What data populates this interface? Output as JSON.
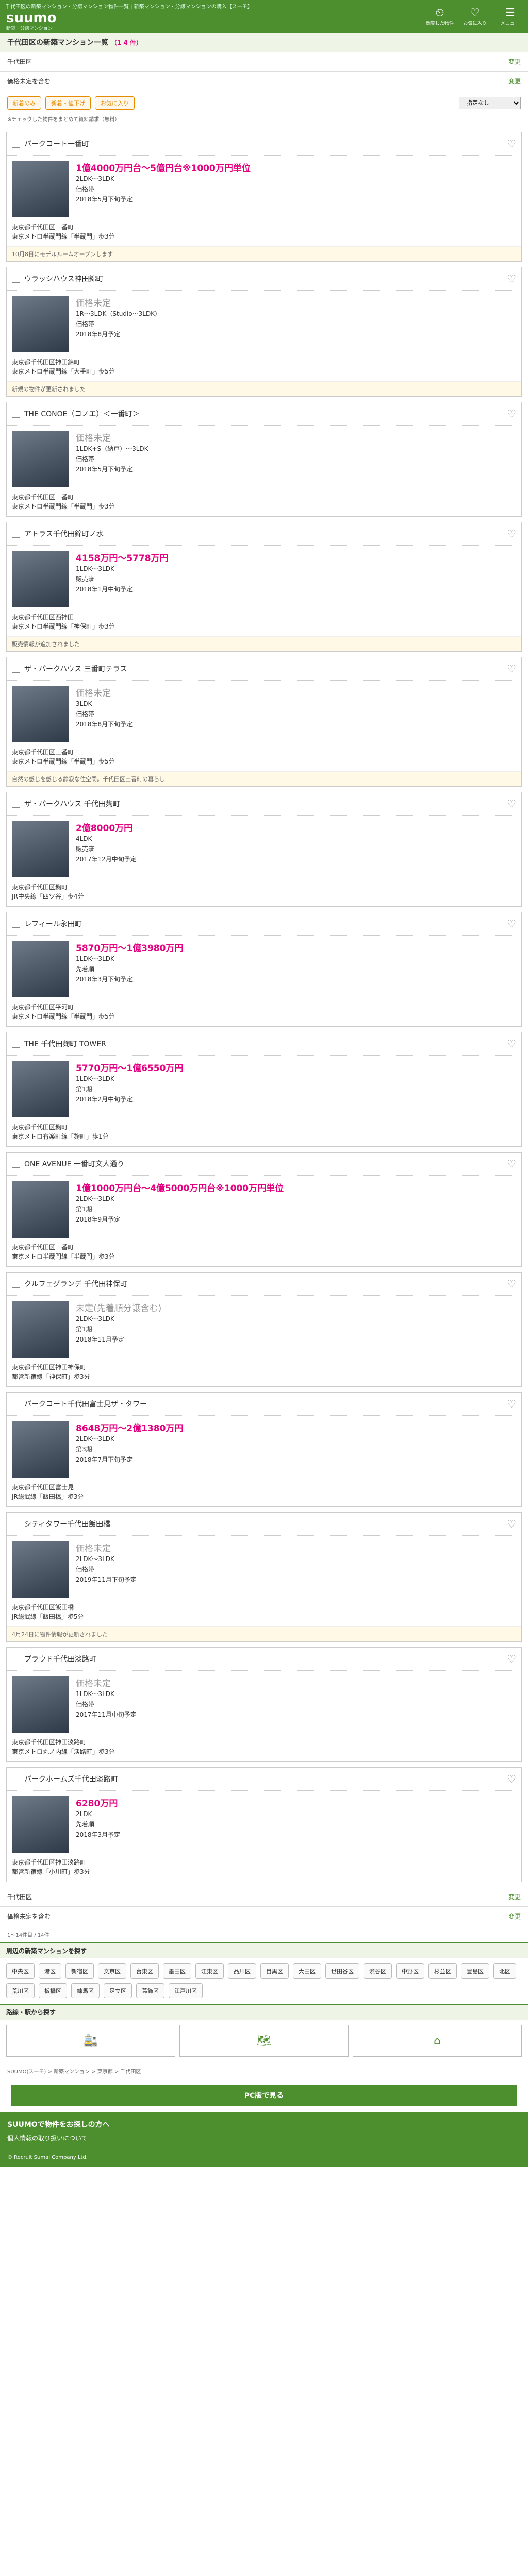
{
  "header": {
    "breadcrumb": "千代田区の新築マンション・分譲マンション物件一覧 | 新築マンション・分譲マンションの購入【スーモ】",
    "logo": "suumo",
    "subtitle": "新築・分譲マンション",
    "icons": [
      {
        "label": "閲覧した物件"
      },
      {
        "label": "お気に入り"
      },
      {
        "label": "メニュー"
      }
    ]
  },
  "title": {
    "text": "千代田区の新築マンション一覧",
    "count": "（1 4 件）"
  },
  "filters": {
    "row1_label": "千代田区",
    "row1_action": "変更",
    "row2_label": "価格未定を含む",
    "row2_action": "変更"
  },
  "buttons": {
    "b1": "新着のみ",
    "b2": "新着・値下げ",
    "b3": "お気に入り",
    "sort": "指定なし"
  },
  "note": "※チェックした物件をまとめて資料請求（無料）",
  "cards": [
    {
      "name": "パークコート一番町",
      "price": "1億4000万円台～5億円台※1000万円単位",
      "plan": "2LDK～3LDK",
      "sub": "価格帯",
      "date": "2018年5月下旬予定",
      "addr1": "東京都千代田区一番町",
      "addr2": "東京メトロ半蔵門線「半蔵門」歩3分",
      "info": "10月8日にモデルルームオープンします"
    },
    {
      "name": "ウラッシハウス神田錦町",
      "price": "価格未定",
      "plan": "1R～3LDK（Studio～3LDK）",
      "sub": "価格帯",
      "date": "2018年8月予定",
      "addr1": "東京都千代田区神田錦町",
      "addr2": "東京メトロ半蔵門線「大手町」歩5分",
      "info": "新規の物件が更新されました"
    },
    {
      "name": "THE CONOE（コノエ）＜一番町＞",
      "price": "価格未定",
      "plan": "1LDK+S（納戸）～3LDK",
      "sub": "価格帯",
      "date": "2018年5月下旬予定",
      "addr1": "東京都千代田区一番町",
      "addr2": "東京メトロ半蔵門線「半蔵門」歩3分",
      "info": ""
    },
    {
      "name": "アトラス千代田錦町ノ水",
      "price": "4158万円～5778万円",
      "plan": "1LDK～3LDK",
      "sub": "販売済",
      "date": "2018年1月中旬予定",
      "addr1": "東京都千代田区西神田",
      "addr2": "東京メトロ半蔵門線「神保町」歩3分",
      "info": "販売情報が追加されました"
    },
    {
      "name": "ザ・パークハウス 三番町テラス",
      "price": "価格未定",
      "plan": "3LDK",
      "sub": "価格帯",
      "date": "2018年8月下旬予定",
      "addr1": "東京都千代田区三番町",
      "addr2": "東京メトロ半蔵門線「半蔵門」歩5分",
      "info": "自然の感じを感じる静寂な住空間。千代田区三番町の暮らし"
    },
    {
      "name": "ザ・パークハウス 千代田麹町",
      "price": "2億8000万円",
      "plan": "4LDK",
      "sub": "販売済",
      "date": "2017年12月中旬予定",
      "addr1": "東京都千代田区麹町",
      "addr2": "JR中央線「四ツ谷」歩4分",
      "info": ""
    },
    {
      "name": "レフィール永田町",
      "price": "5870万円～1億3980万円",
      "plan": "1LDK～3LDK",
      "sub": "先着順",
      "date": "2018年3月下旬予定",
      "addr1": "東京都千代田区平河町",
      "addr2": "東京メトロ半蔵門線「半蔵門」歩5分",
      "info": ""
    },
    {
      "name": "THE 千代田麹町 TOWER",
      "price": "5770万円～1億6550万円",
      "plan": "1LDK～3LDK",
      "sub": "第1期",
      "date": "2018年2月中旬予定",
      "addr1": "東京都千代田区麹町",
      "addr2": "東京メトロ有楽町線「麹町」歩1分",
      "info": ""
    },
    {
      "name": "ONE AVENUE 一番町文人通り",
      "price": "1億1000万円台～4億5000万円台※1000万円単位",
      "plan": "2LDK～3LDK",
      "sub": "第1期",
      "date": "2018年9月予定",
      "addr1": "東京都千代田区一番町",
      "addr2": "東京メトロ半蔵門線「半蔵門」歩3分",
      "info": ""
    },
    {
      "name": "クルフェグランデ 千代田神保町",
      "price": "未定(先着順分譲含む)",
      "plan": "2LDK～3LDK",
      "sub": "第1期",
      "date": "2018年11月予定",
      "addr1": "東京都千代田区神田神保町",
      "addr2": "都営新宿線「神保町」歩3分",
      "info": ""
    },
    {
      "name": "パークコート千代田富士見ザ・タワー",
      "price": "8648万円～2億1380万円",
      "plan": "2LDK～3LDK",
      "sub": "第3期",
      "date": "2018年7月下旬予定",
      "addr1": "東京都千代田区富士見",
      "addr2": "JR総武線「飯田橋」歩3分",
      "info": ""
    },
    {
      "name": "シティタワー千代田飯田橋",
      "price": "価格未定",
      "plan": "2LDK～3LDK",
      "sub": "価格帯",
      "date": "2019年11月下旬予定",
      "addr1": "東京都千代田区飯田橋",
      "addr2": "JR総武線「飯田橋」歩5分",
      "info": "4月24日に物件情報が更新されました"
    },
    {
      "name": "プラウド千代田淡路町",
      "price": "価格未定",
      "plan": "1LDK～3LDK",
      "sub": "価格帯",
      "date": "2017年11月中旬予定",
      "addr1": "東京都千代田区神田淡路町",
      "addr2": "東京メトロ丸ノ内線「淡路町」歩3分",
      "info": ""
    },
    {
      "name": "パークホームズ千代田淡路町",
      "price": "6280万円",
      "plan": "2LDK",
      "sub": "先着順",
      "date": "2018年3月予定",
      "addr1": "東京都千代田区神田淡路町",
      "addr2": "都営新宿線「小川町」歩3分",
      "info": ""
    }
  ],
  "bottom": {
    "filter1": "千代田区",
    "filter2": "価格未定を含む",
    "pager": "1～14件目 / 14件",
    "section1": "周辺の新築マンションを探す",
    "wards": [
      "中央区",
      "港区",
      "新宿区",
      "文京区",
      "台東区",
      "墨田区",
      "江東区",
      "品川区",
      "目黒区",
      "大田区",
      "世田谷区",
      "渋谷区",
      "中野区",
      "杉並区",
      "豊島区",
      "北区",
      "荒川区",
      "板橋区",
      "練馬区",
      "足立区",
      "葛飾区",
      "江戸川区"
    ],
    "section2": "路線・駅から探す",
    "area_labels": [
      "路線・駅",
      "地図",
      "都道府県"
    ],
    "breadcrumb": "SUUMO(スーモ) > 新築マンション > 東京都 > 千代田区",
    "bigbutton": "PC版で見る",
    "footer_title": "SUUMOで物件をお探しの方へ",
    "footer_line": "個人情報の取り扱いについて",
    "copyright": "© Recruit Sumai Company Ltd."
  }
}
